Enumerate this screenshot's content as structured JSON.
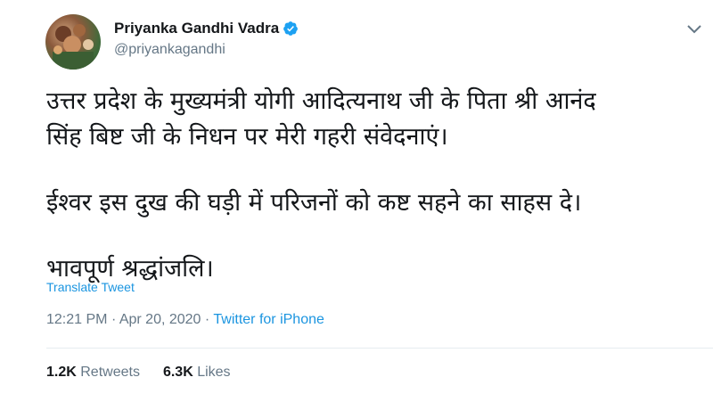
{
  "user": {
    "name": "Priyanka Gandhi Vadra",
    "handle": "@priyankagandhi"
  },
  "tweet": {
    "lines": [
      "उत्तर प्रदेश के मुख्यमंत्री योगी आदित्यनाथ जी के पिता श्री आनंद",
      "सिंह बिष्ट जी के  निधन पर मेरी गहरी संवेदनाएं।",
      "ईश्वर इस दुख की घड़ी में परिजनों को कष्ट सहने का साहस दे।",
      "भावपूर्ण श्रद्धांजलि।"
    ],
    "translate_label": "Translate Tweet",
    "time": "12:21 PM",
    "separator": "·",
    "date": "Apr 20, 2020",
    "source": "Twitter for iPhone",
    "retweets": "1.2K",
    "retweets_label": "Retweets",
    "likes": "6.3K",
    "likes_label": "Likes"
  },
  "icons": {
    "verified": "verified-badge-icon",
    "menu": "chevron-down-icon"
  },
  "colors": {
    "accent": "#1b95e0",
    "muted": "#657786",
    "text": "#14171a"
  }
}
